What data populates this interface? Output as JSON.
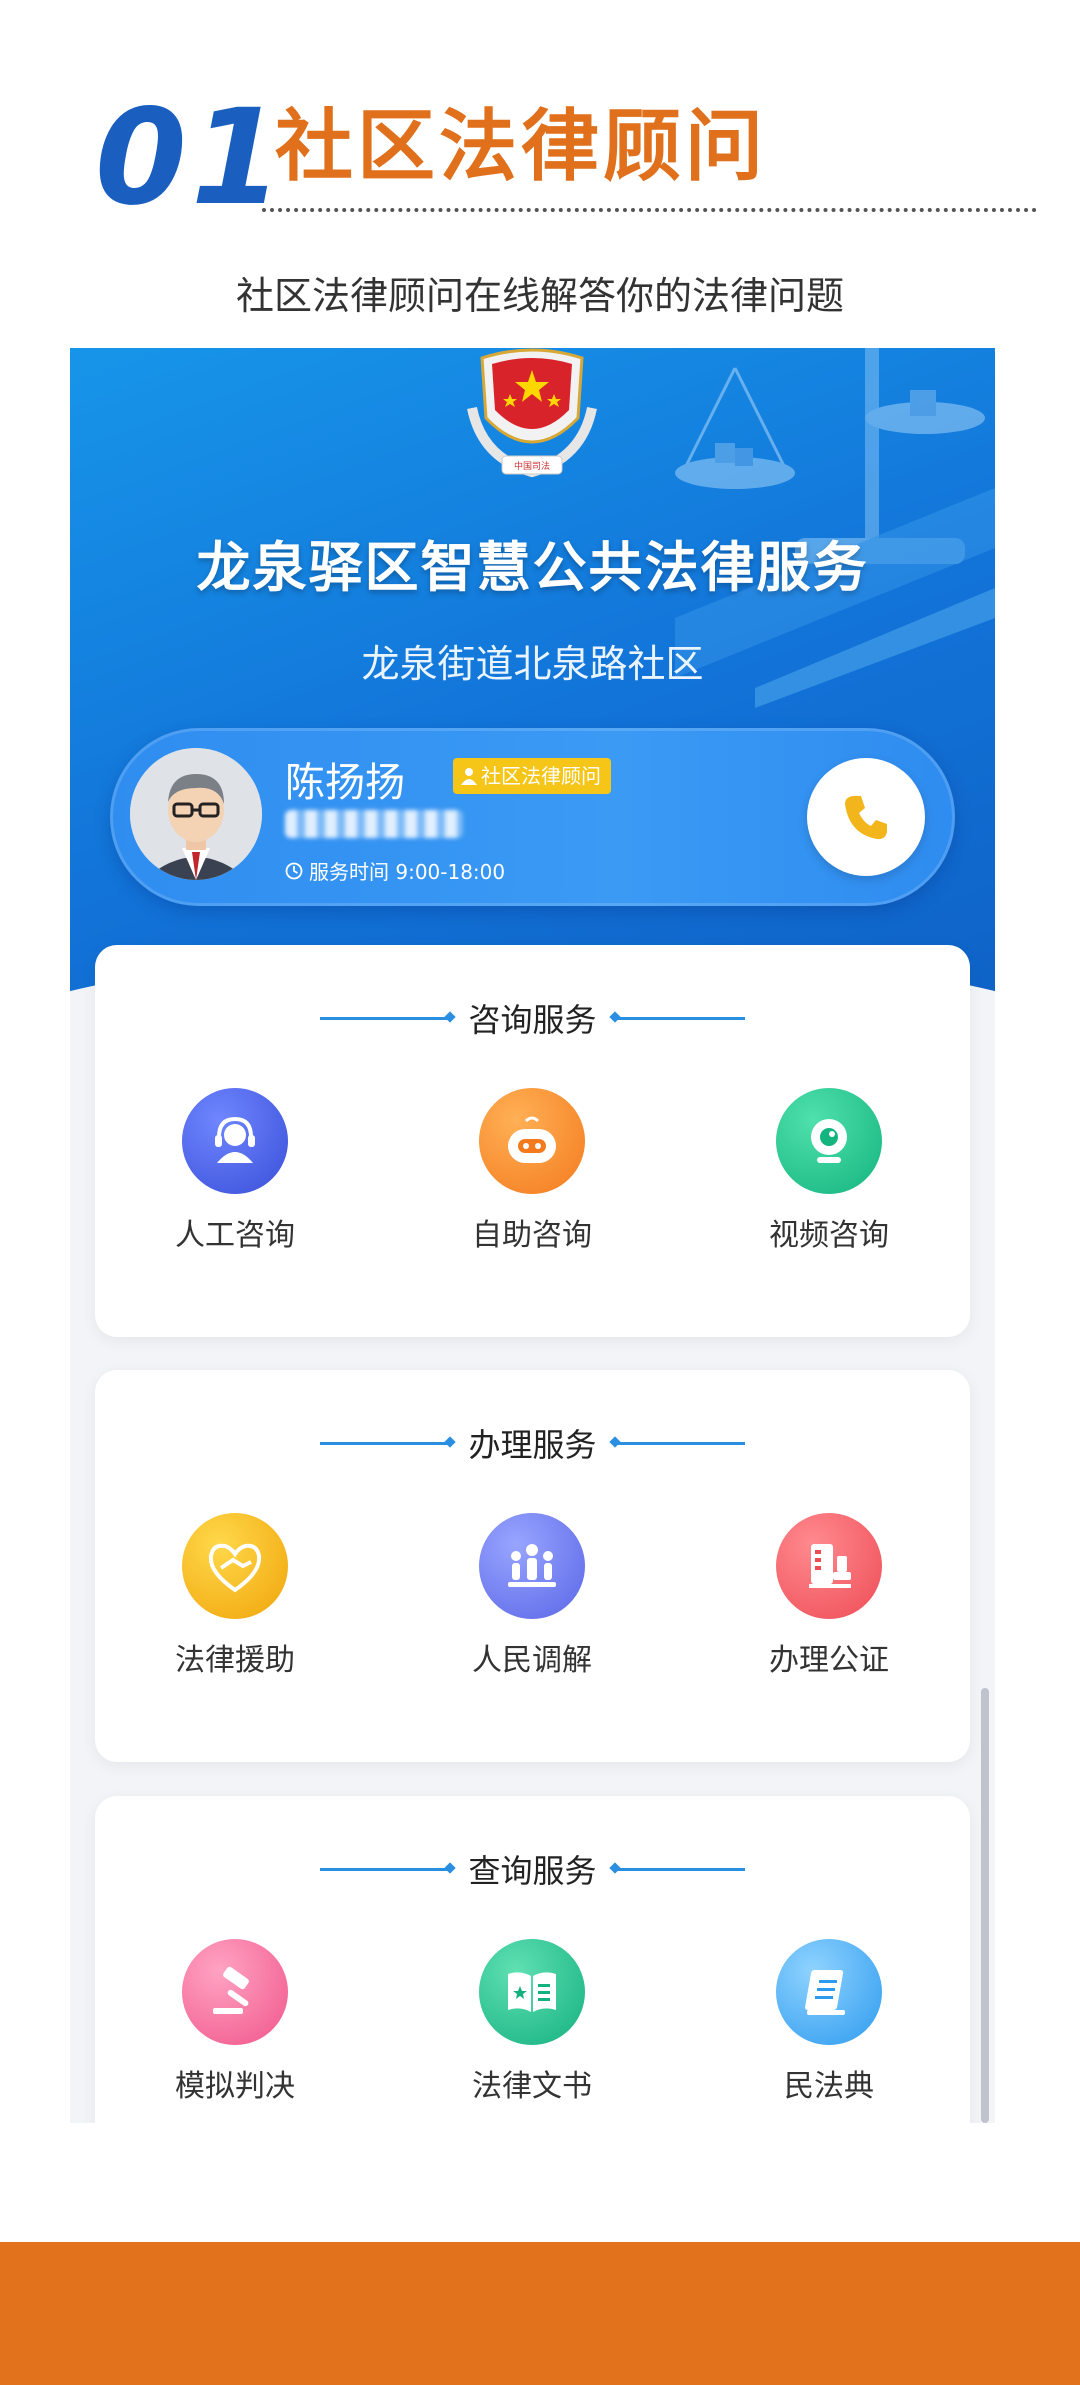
{
  "header": {
    "number": "01",
    "title": "社区法律顾问",
    "subtitle": "社区法律顾问在线解答你的法律问题"
  },
  "banner": {
    "title": "龙泉驿区智慧公共法律服务",
    "subtitle": "龙泉街道北泉路社区",
    "emblem_text": "中国司法"
  },
  "counsel": {
    "name": "陈扬扬",
    "badge": "社区法律顾问",
    "hours": "服务时间 9:00-18:00"
  },
  "sections": [
    {
      "title": "咨询服务",
      "items": [
        {
          "label": "人工咨询",
          "icon": "headset-person-icon",
          "color": "#3f5be0"
        },
        {
          "label": "自助咨询",
          "icon": "robot-icon",
          "color": "#f78a2a"
        },
        {
          "label": "视频咨询",
          "icon": "webcam-icon",
          "color": "#1fc58e"
        }
      ]
    },
    {
      "title": "办理服务",
      "items": [
        {
          "label": "法律援助",
          "icon": "handshake-heart-icon",
          "color": "#f5b812"
        },
        {
          "label": "人民调解",
          "icon": "people-group-icon",
          "color": "#6a78ee"
        },
        {
          "label": "办理公证",
          "icon": "notary-stamp-icon",
          "color": "#f35a62"
        }
      ]
    },
    {
      "title": "查询服务",
      "items": [
        {
          "label": "模拟判决",
          "icon": "gavel-icon",
          "color": "#f56a96"
        },
        {
          "label": "法律文书",
          "icon": "law-book-icon",
          "color": "#1fc08c"
        },
        {
          "label": "民法典",
          "icon": "civil-code-book-icon",
          "color": "#3fa6f0"
        }
      ]
    }
  ],
  "colors": {
    "accent_orange": "#e2731c",
    "number_blue": "#1a5fbf",
    "banner_blue": "#1384e3"
  }
}
